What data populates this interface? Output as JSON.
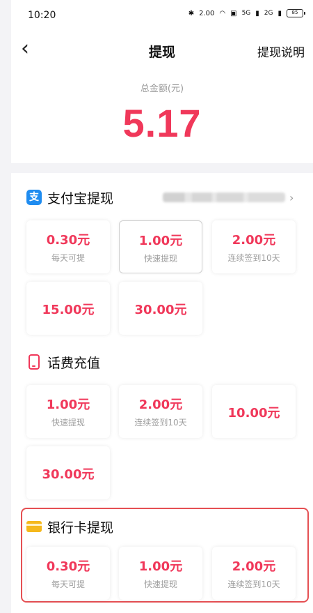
{
  "status_bar": {
    "time": "10:20",
    "net_speed": "2.00",
    "signal_1": "5G",
    "signal_2": "2G",
    "battery": "85"
  },
  "nav": {
    "back_glyph": "‹",
    "title": "提现",
    "explain_label": "提现说明"
  },
  "summary": {
    "total_label": "总金额(元)",
    "total_amount": "5.17"
  },
  "alipay": {
    "icon": "alipay-icon",
    "icon_glyph": "支",
    "title": "支付宝提现",
    "chevron": "›",
    "options": [
      {
        "amount": "0.30元",
        "note": "每天可提"
      },
      {
        "amount": "1.00元",
        "note": "快速提现"
      },
      {
        "amount": "2.00元",
        "note": "连续签到10天"
      },
      {
        "amount": "15.00元"
      },
      {
        "amount": "30.00元"
      }
    ]
  },
  "phone": {
    "icon": "phone-icon",
    "title": "话费充值",
    "options": [
      {
        "amount": "1.00元",
        "note": "快速提现"
      },
      {
        "amount": "2.00元",
        "note": "连续签到10天"
      },
      {
        "amount": "10.00元"
      },
      {
        "amount": "30.00元"
      }
    ]
  },
  "bank": {
    "icon": "bank-card-icon",
    "title": "银行卡提现",
    "options": [
      {
        "amount": "0.30元",
        "note": "每天可提"
      },
      {
        "amount": "1.00元",
        "note": "快速提现"
      },
      {
        "amount": "2.00元",
        "note": "连续签到10天"
      }
    ]
  },
  "colors": {
    "accent": "#f0385a",
    "highlight_frame": "#e55053",
    "alipay_blue": "#1f8cf0",
    "card_yellow": "#f5b81c"
  }
}
